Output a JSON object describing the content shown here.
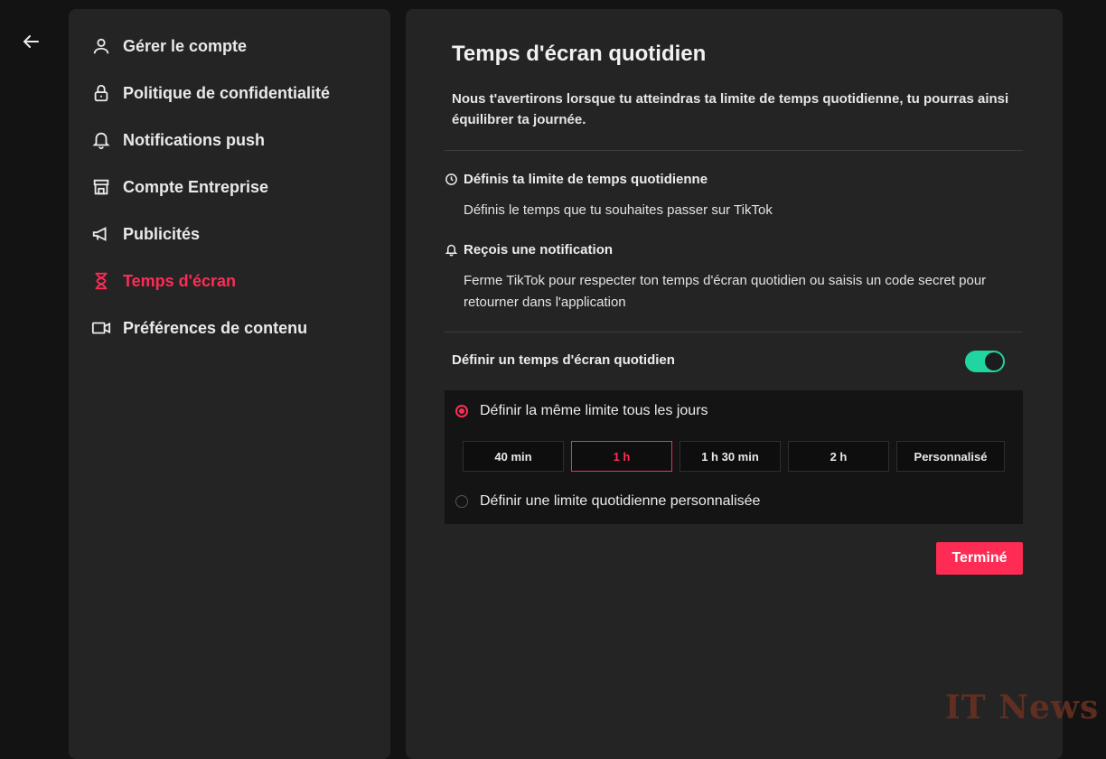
{
  "sidebar": {
    "items": [
      {
        "label": "Gérer le compte",
        "icon": "user-icon"
      },
      {
        "label": "Politique de confidentialité",
        "icon": "lock-icon"
      },
      {
        "label": "Notifications push",
        "icon": "bell-icon"
      },
      {
        "label": "Compte Entreprise",
        "icon": "store-icon"
      },
      {
        "label": "Publicités",
        "icon": "megaphone-icon"
      },
      {
        "label": "Temps d'écran",
        "icon": "hourglass-icon",
        "active": true
      },
      {
        "label": "Préférences de contenu",
        "icon": "video-icon"
      }
    ]
  },
  "main": {
    "title": "Temps d'écran quotidien",
    "description": "Nous t'avertirons lorsque tu atteindras ta limite de temps quotidienne, tu pourras ainsi équilibrer ta journée.",
    "info": [
      {
        "heading": "Définis ta limite de temps quotidienne",
        "text": "Définis le temps que tu souhaites passer sur TikTok",
        "icon": "clock-icon"
      },
      {
        "heading": "Reçois une notification",
        "text": "Ferme TikTok pour respecter ton temps d'écran quotidien ou saisis un code secret pour retourner dans l'application",
        "icon": "bell-icon"
      }
    ],
    "toggle_label": "Définir un temps d'écran quotidien",
    "toggle_on": true,
    "options": {
      "same_limit_label": "Définir la même limite tous les jours",
      "custom_limit_label": "Définir une limite quotidienne personnalisée",
      "durations": [
        "40 min",
        "1 h",
        "1 h 30 min",
        "2 h",
        "Personnalisé"
      ],
      "selected": "1 h"
    },
    "done_label": "Terminé"
  },
  "watermark": "IT News",
  "colors": {
    "accent": "#fe2c55",
    "toggle": "#20d5a0",
    "panel": "#242424",
    "background": "#131313"
  }
}
